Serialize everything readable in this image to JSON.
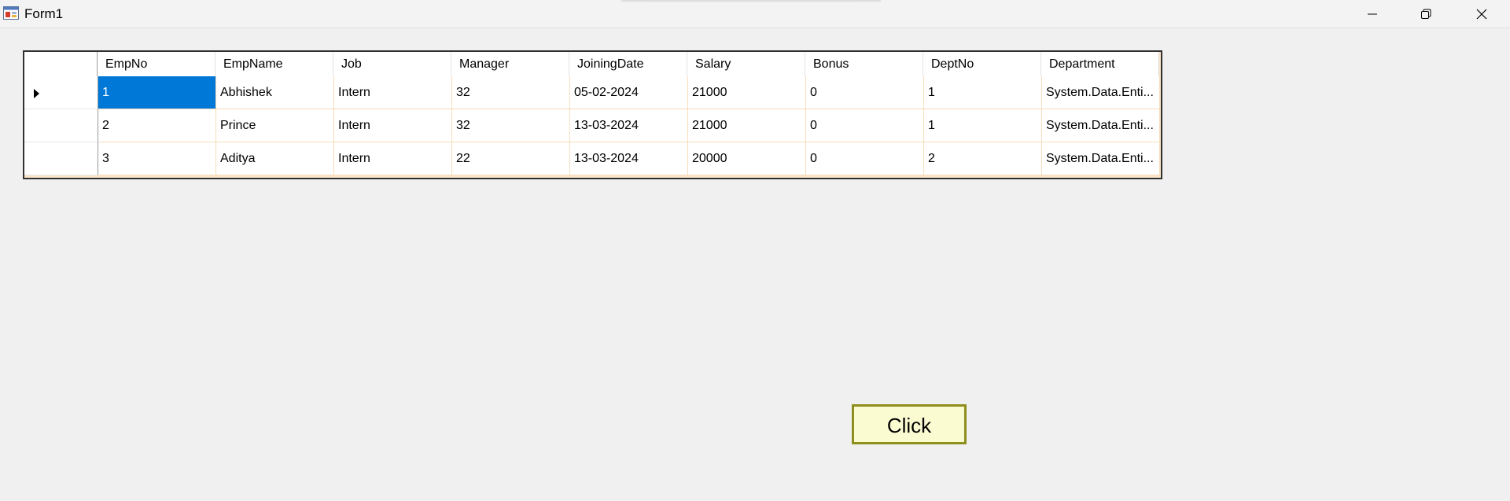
{
  "window": {
    "title": "Form1"
  },
  "grid": {
    "columns": [
      "EmpNo",
      "EmpName",
      "Job",
      "Manager",
      "JoiningDate",
      "Salary",
      "Bonus",
      "DeptNo",
      "Department"
    ],
    "rows": [
      [
        "1",
        "Abhishek",
        "Intern",
        "32",
        "05-02-2024",
        "21000",
        "0",
        "1",
        "System.Data.Enti..."
      ],
      [
        "2",
        "Prince",
        "Intern",
        "32",
        "13-03-2024",
        "21000",
        "0",
        "1",
        "System.Data.Enti..."
      ],
      [
        "3",
        "Aditya",
        "Intern",
        "22",
        "13-03-2024",
        "20000",
        "0",
        "2",
        "System.Data.Enti..."
      ]
    ],
    "selected_row": 0,
    "selected_col": 0
  },
  "button": {
    "label": "Click"
  },
  "colors": {
    "selection": "#0078d7",
    "grid_background": "#fbe6cc",
    "button_background": "#fbfbd2",
    "button_border": "#8e8e1e"
  }
}
